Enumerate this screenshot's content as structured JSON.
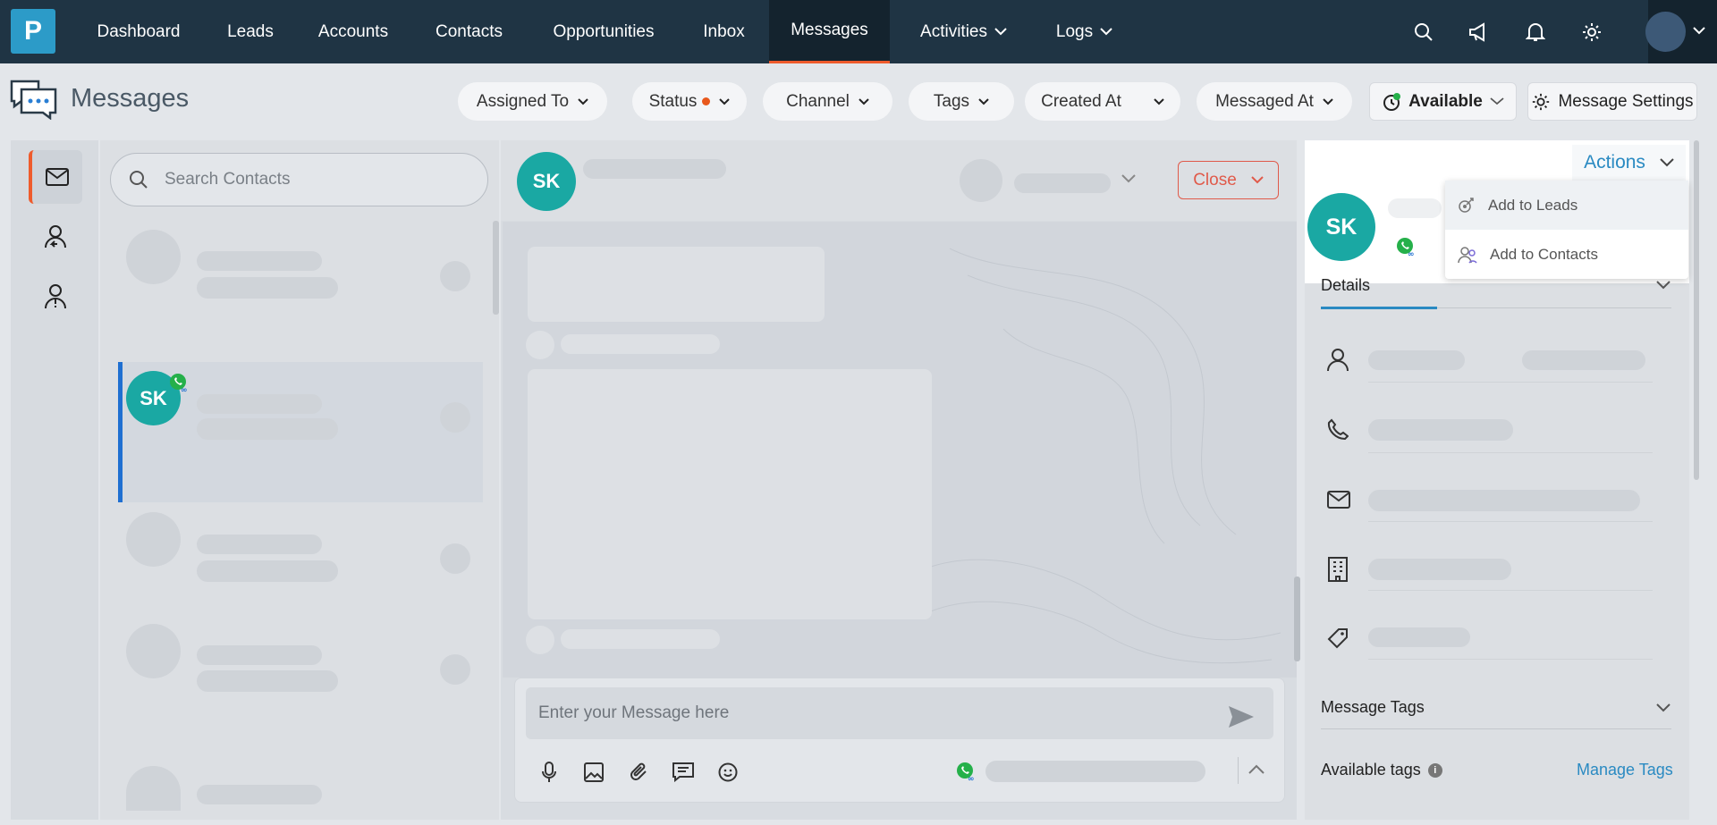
{
  "nav": {
    "logo_letter": "P",
    "items": [
      {
        "label": "Dashboard"
      },
      {
        "label": "Leads"
      },
      {
        "label": "Accounts"
      },
      {
        "label": "Contacts"
      },
      {
        "label": "Opportunities"
      },
      {
        "label": "Inbox"
      },
      {
        "label": "Messages"
      },
      {
        "label": "Activities"
      },
      {
        "label": "Logs"
      }
    ],
    "active_tab": "Messages",
    "icons": [
      "search-icon",
      "megaphone-icon",
      "bell-icon",
      "gear-icon"
    ]
  },
  "page": {
    "title": "Messages"
  },
  "filters": [
    {
      "label": "Assigned To"
    },
    {
      "label": "Status"
    },
    {
      "label": "Channel"
    },
    {
      "label": "Tags"
    },
    {
      "label": "Created At"
    },
    {
      "label": "Messaged At"
    }
  ],
  "status_dot_color": "#e8581c",
  "availability": {
    "label": "Available"
  },
  "message_settings": {
    "label": "Message Settings"
  },
  "search": {
    "placeholder": "Search Contacts"
  },
  "contact": {
    "initials": "SK"
  },
  "chat": {
    "initials": "SK",
    "close_label": "Close",
    "composer_placeholder": "Enter your Message here"
  },
  "actions": {
    "label": "Actions",
    "menu": [
      {
        "label": "Add to Leads"
      },
      {
        "label": "Add to Contacts"
      }
    ]
  },
  "details": {
    "initials": "SK",
    "tab_label": "Details",
    "message_tags_label": "Message Tags",
    "available_tags_label": "Available tags",
    "manage_tags_label": "Manage Tags"
  },
  "colors": {
    "nav_bg": "#1f3444",
    "accent_orange": "#ee5b2c",
    "teal_avatar": "#1aa8a3",
    "link_blue": "#2a8ac2",
    "whatsapp_green": "#25b04a"
  }
}
